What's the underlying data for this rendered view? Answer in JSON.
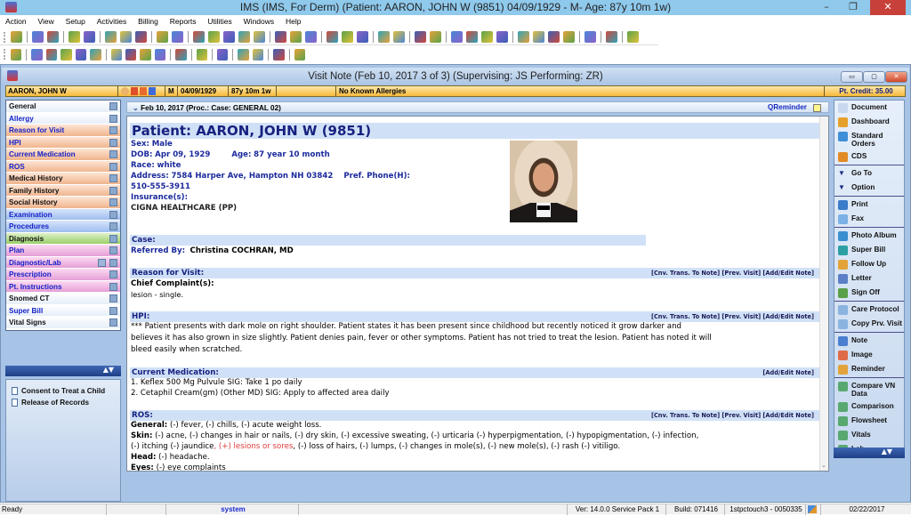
{
  "window": {
    "title": "IMS (IMS, For Derm)    (Patient: AARON, JOHN W (9851) 04/09/1929 - M- Age: 87y 10m 1w)",
    "minimize": "–",
    "restore": "❐",
    "close": "✕"
  },
  "menu": [
    "Action",
    "View",
    "Setup",
    "Activities",
    "Billing",
    "Reports",
    "Utilities",
    "Windows",
    "Help"
  ],
  "toolbar1_icons": [
    "patient-icon",
    "patient-check-icon",
    "patient-edit-icon",
    "folder-icon",
    "edit-icon",
    "lab-order-icon",
    "flask-icon",
    "shield-icon",
    "document-icon",
    "notes-icon",
    "dollar-icon",
    "billing-icon",
    "claims-icon",
    "payment-icon",
    "ledger-icon",
    "calendar-icon",
    "schedule-icon",
    "letter-icon",
    "fax-icon",
    "scan-icon",
    "scan2-icon",
    "report-icon",
    "report2-icon",
    "chart-icon",
    "user-report-icon",
    "sync-icon",
    "transfer-icon",
    "word-icon",
    "spell-icon",
    "grid-icon",
    "image-icon",
    "toggle-icon",
    "list-icon",
    "help-icon",
    "lock-icon",
    "exit-icon"
  ],
  "toolbar2_icons": [
    "open-folder-icon",
    "add-icon",
    "edit-note-icon",
    "remove-icon",
    "print-icon",
    "heart-icon",
    "first-icon",
    "prev-icon",
    "next-icon",
    "last-icon",
    "refresh-icon",
    "copy-icon",
    "template-icon",
    "search-doc-icon",
    "settings-icon",
    "help-icon",
    "close-circle-icon"
  ],
  "visit_note": {
    "title": "Visit Note (Feb 10, 2017   3 of 3) (Supervising: JS Performing: ZR)"
  },
  "patient_bar": {
    "name": "AARON, JOHN W",
    "sex": "M",
    "dob": "04/09/1929",
    "age": "87y 10m 1w",
    "blank": "",
    "allergies": "No Known Allergies",
    "credit": "Pt. Credit: 35.00"
  },
  "left_nav": [
    {
      "label": "General",
      "style": "white",
      "color": "black"
    },
    {
      "label": "Allergy",
      "style": "white",
      "color": "blue"
    },
    {
      "label": "Reason for Visit",
      "style": "orange",
      "color": "blue"
    },
    {
      "label": "HPI",
      "style": "orange",
      "color": "blue"
    },
    {
      "label": "Current Medication",
      "style": "orange",
      "color": "blue"
    },
    {
      "label": "ROS",
      "style": "orange",
      "color": "blue"
    },
    {
      "label": "Medical History",
      "style": "orange",
      "color": "black"
    },
    {
      "label": "Family History",
      "style": "orange",
      "color": "black"
    },
    {
      "label": "Social History",
      "style": "orange",
      "color": "black"
    },
    {
      "label": "Examination",
      "style": "blue",
      "color": "blue"
    },
    {
      "label": "Procedures",
      "style": "blue",
      "color": "blue"
    },
    {
      "label": "Diagnosis",
      "style": "green",
      "color": "black"
    },
    {
      "label": "Plan",
      "style": "pink",
      "color": "blue"
    },
    {
      "label": "Diagnostic/Lab",
      "style": "pink",
      "color": "blue"
    },
    {
      "label": "Prescription",
      "style": "pink",
      "color": "blue"
    },
    {
      "label": "Pt. Instructions",
      "style": "pink",
      "color": "blue"
    },
    {
      "label": "Snomed CT",
      "style": "white",
      "color": "black"
    },
    {
      "label": "Super Bill",
      "style": "white",
      "color": "blue"
    },
    {
      "label": "Vital Signs",
      "style": "white",
      "color": "black"
    }
  ],
  "nav_scroll": "▲▼",
  "consent_forms": [
    "Consent to Treat a Child",
    "Release of Records"
  ],
  "section_header": {
    "text": "Feb 10, 2017  (Proc.:   Case: GENERAL 02)",
    "qreminder": "QReminder"
  },
  "note": {
    "patient_heading": "Patient: AARON, JOHN W  (9851)",
    "sex_label": "Sex:",
    "sex": "Male",
    "dob_label": "DOB:",
    "dob": "Apr 09, 1929",
    "age_label": "Age:",
    "age": "87 year 10 month",
    "race_label": "Race:",
    "race": "white",
    "address_label": "Address:",
    "address": "7584 Harper Ave,  Hampton  NH  03842",
    "phone_label": "Pref. Phone(H):",
    "phone": "510-555-3911",
    "insurance_label": "Insurance(s):",
    "insurance": "CIGNA HEALTHCARE (PP)",
    "case_heading": "Case:",
    "referred_label": "Referred By:",
    "referred": "Christina COCHRAN, MD",
    "rfv_heading": "Reason for Visit:",
    "links3": "[Cnv. Trans. To Note]  [Prev. Visit]  [Add/Edit Note]",
    "links1": "[Add/Edit Note]",
    "cc_label": "Chief Complaint(s):",
    "cc": "lesion - single.",
    "hpi_heading": "HPI:",
    "hpi_lines": [
      "*** Patient presents with dark mole on right shoulder. Patient states it has been present since childhood but recently noticed it grow darker and",
      "believes it has also grown in size slightly. Patient denies pain, fever or other symptoms. Patient has not tried to treat the lesion. Patient has noted it will",
      "bleed easily when scratched."
    ],
    "med_heading": "Current Medication:",
    "meds": [
      "1. Keflex 500 Mg Pulvule  SIG: Take 1 po daily",
      "2. Cetaphil   Cream(gm) (Other MD)  SIG: Apply to affected area daily"
    ],
    "ros_heading": "ROS:",
    "ros_general_label": "General:",
    "ros_general": " (-) fever, (-) chills, (-) acute weight loss.",
    "ros_skin_label": "Skin:",
    "ros_skin_1": "  (-) acne, (-) changes in hair or nails, (-) dry skin, (-) excessive sweating, (-) urticaria (-) hyperpigmentation, (-) hypopigmentation, (-) infection,",
    "ros_skin_2a": "(-) itching (-) jaundice",
    "ros_skin_2b": ", (+) lesions or sores",
    "ros_skin_2c": ", (-) loss of hairs, (-) lumps, (-) changes in mole(s), (-) new mole(s), (-) rash (-) vitiligo.",
    "ros_head_label": "Head:",
    "ros_head": " (-) headache.",
    "ros_eyes_label": "Eyes:",
    "ros_eyes": " (-) eye complaints"
  },
  "right_nav": [
    {
      "label": "Document",
      "icon": "document-icon",
      "color": "#c9d7ee"
    },
    {
      "label": "Dashboard",
      "icon": "dashboard-icon",
      "color": "#e6a12c"
    },
    {
      "label": "Standard Orders",
      "icon": "standard-orders-icon",
      "color": "#3f8fd8"
    },
    {
      "label": "CDS",
      "icon": "cds-icon",
      "color": "#e28a24"
    },
    {
      "sep": true
    },
    {
      "label": "Go To",
      "icon": "triangle-down-icon",
      "color": "#1a2d86"
    },
    {
      "label": "Option",
      "icon": "triangle-down-icon",
      "color": "#1a2d86"
    },
    {
      "sep": true
    },
    {
      "label": "Print",
      "icon": "print-icon",
      "color": "#3a7cc9"
    },
    {
      "label": "Fax",
      "icon": "fax-icon",
      "color": "#7bb1e4"
    },
    {
      "sep": true
    },
    {
      "label": "Photo Album",
      "icon": "photo-album-icon",
      "color": "#3a8fd0"
    },
    {
      "label": "Super Bill",
      "icon": "super-bill-icon",
      "color": "#2c9fa4"
    },
    {
      "label": "Follow Up",
      "icon": "follow-up-icon",
      "color": "#e3a33a"
    },
    {
      "label": "Letter",
      "icon": "letter-icon",
      "color": "#5a7ec7"
    },
    {
      "label": "Sign Off",
      "icon": "sign-off-icon",
      "color": "#5aa04a"
    },
    {
      "sep": true
    },
    {
      "label": "Care Protocol",
      "icon": "care-protocol-icon",
      "color": "#8ab3e0"
    },
    {
      "label": "Copy Prv. Visit",
      "icon": "copy-visit-icon",
      "color": "#8ab3e0"
    },
    {
      "sep": true
    },
    {
      "label": "Note",
      "icon": "note-icon",
      "color": "#4a7fd0"
    },
    {
      "label": "Image",
      "icon": "image-icon",
      "color": "#e06b4a"
    },
    {
      "label": "Reminder",
      "icon": "reminder-icon",
      "color": "#e3a33a"
    },
    {
      "sep": true
    },
    {
      "label": "Compare VN Data",
      "icon": "compare-icon",
      "color": "#58a870"
    },
    {
      "label": "Comparison",
      "icon": "comparison-icon",
      "color": "#58a870"
    },
    {
      "label": "Flowsheet",
      "icon": "flowsheet-icon",
      "color": "#58a870"
    },
    {
      "label": "Vitals",
      "icon": "vitals-icon",
      "color": "#58a870"
    },
    {
      "label": "Lab",
      "icon": "lab-icon",
      "color": "#58a870"
    }
  ],
  "right_scroll": "▲▼",
  "status": {
    "ready": "Ready",
    "user": "system",
    "version": "Ver: 14.0.0 Service Pack 1",
    "build": "Build: 071416",
    "station": "1stpctouch3 - 0050335",
    "date": "02/22/2017"
  },
  "colors": {
    "title_bar": "#8fc9ec",
    "section_header_bg": "#d0e1f7",
    "heading_text": "#16217f",
    "label_blue": "#1b2a9c",
    "positive_finding": "#e23b3b",
    "patient_bar": "#f6b93b"
  }
}
